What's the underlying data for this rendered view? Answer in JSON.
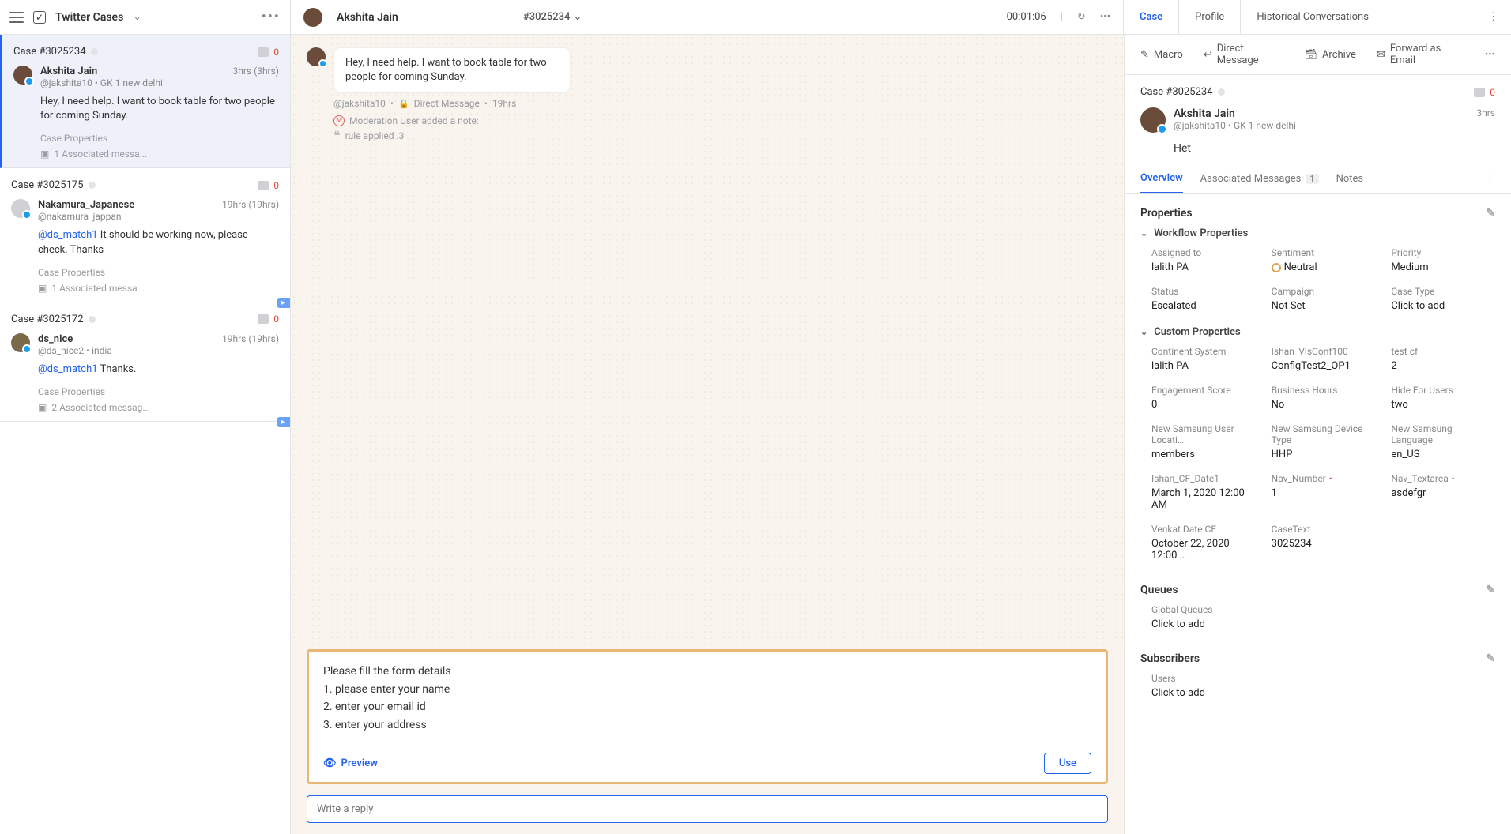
{
  "header": {
    "left_title": "Twitter Cases",
    "middle_name": "Akshita Jain",
    "case_hash": "#3025234",
    "timer": "00:01:06"
  },
  "right_tabs": {
    "case": "Case",
    "profile": "Profile",
    "historical": "Historical Conversations"
  },
  "cases": [
    {
      "id": "Case #3025234",
      "msgcount": "0",
      "name": "Akshita Jain",
      "handle": "@jakshita10",
      "extra": "GK 1 new delhi",
      "time": "3hrs  (3hrs)",
      "mention": "",
      "msg": "Hey, I need help. I want to book table for two people for coming Sunday.",
      "assoc": "1 Associated messa...",
      "selected": true,
      "escal": false,
      "avatar_color": "#6b4b3a"
    },
    {
      "id": "Case #3025175",
      "msgcount": "0",
      "name": "Nakamura_Japanese",
      "handle": "@nakamura_jappan",
      "extra": "",
      "time": "19hrs  (19hrs)",
      "mention": "@ds_match1",
      "msg": " It should be working now, please check. Thanks",
      "assoc": "1 Associated messa...",
      "selected": false,
      "escal": true,
      "avatar_color": "#d0d0d5"
    },
    {
      "id": "Case #3025172",
      "msgcount": "0",
      "name": "ds_nice",
      "handle": "@ds_nice2",
      "extra": "india",
      "time": "19hrs  (19hrs)",
      "mention": "@ds_match1",
      "msg": " Thanks.",
      "assoc": "2 Associated messag...",
      "selected": false,
      "escal": true,
      "avatar_color": "#7a6a4a"
    }
  ],
  "case_props_label": "Case Properties",
  "conversation": {
    "bubble": "Hey, I need help. I want to book table for two people for coming Sunday.",
    "meta_handle": "@jakshita10",
    "meta_channel": "Direct Message",
    "meta_time": "19hrs",
    "modnote": "Moderation User added a note:",
    "rule": "rule applied .3"
  },
  "suggest": {
    "lines": [
      "Please fill the form details",
      "1. please enter your name",
      "2. enter your email id",
      "3. enter your address"
    ],
    "preview": "Preview",
    "use": "Use"
  },
  "reply_placeholder": "Write a reply",
  "panel_actions": {
    "macro": "Macro",
    "dm": "Direct Message",
    "archive": "Archive",
    "forward": "Forward as Email"
  },
  "panel": {
    "case_id": "Case #3025234",
    "msgcount": "0",
    "name": "Akshita Jain",
    "handle": "@jakshita10",
    "extra": "GK 1 new delhi",
    "time": "3hrs",
    "msg": "Het"
  },
  "panel_tabs": {
    "overview": "Overview",
    "assoc": "Associated Messages",
    "assoc_count": "1",
    "notes": "Notes"
  },
  "properties": {
    "title": "Properties",
    "workflow_title": "Workflow Properties",
    "custom_title": "Custom Properties",
    "workflow": [
      {
        "l": "Assigned to",
        "v": "lalith PA"
      },
      {
        "l": "Sentiment",
        "v": "Neutral",
        "sentiment": true
      },
      {
        "l": "Priority",
        "v": "Medium"
      },
      {
        "l": "Status",
        "v": "Escalated"
      },
      {
        "l": "Campaign",
        "v": "Not Set"
      },
      {
        "l": "Case Type",
        "v": "Click to add"
      }
    ],
    "custom": [
      {
        "l": "Continent System",
        "v": "lalith PA"
      },
      {
        "l": "Ishan_VisConf100",
        "v": "ConfigTest2_OP1"
      },
      {
        "l": "test cf",
        "v": "2"
      },
      {
        "l": "Engagement Score",
        "v": "0"
      },
      {
        "l": "Business Hours",
        "v": "No"
      },
      {
        "l": "Hide For Users",
        "v": "two"
      },
      {
        "l": "New Samsung User Locati…",
        "v": "members"
      },
      {
        "l": "New Samsung Device Type",
        "v": "HHP"
      },
      {
        "l": "New Samsung Language",
        "v": "en_US"
      },
      {
        "l": "Ishan_CF_Date1",
        "v": "March 1, 2020 12:00 AM"
      },
      {
        "l": "Nav_Number",
        "v": "1",
        "req": true
      },
      {
        "l": "Nav_Textarea",
        "v": "asdefgr",
        "req": true
      },
      {
        "l": "Venkat Date CF",
        "v": "October 22, 2020 12:00 …"
      },
      {
        "l": "CaseText",
        "v": "3025234"
      }
    ]
  },
  "queues": {
    "title": "Queues",
    "sub_label": "Global Queues",
    "sub_value": "Click to add"
  },
  "subscribers": {
    "title": "Subscribers",
    "sub_label": "Users",
    "sub_value": "Click to add"
  }
}
